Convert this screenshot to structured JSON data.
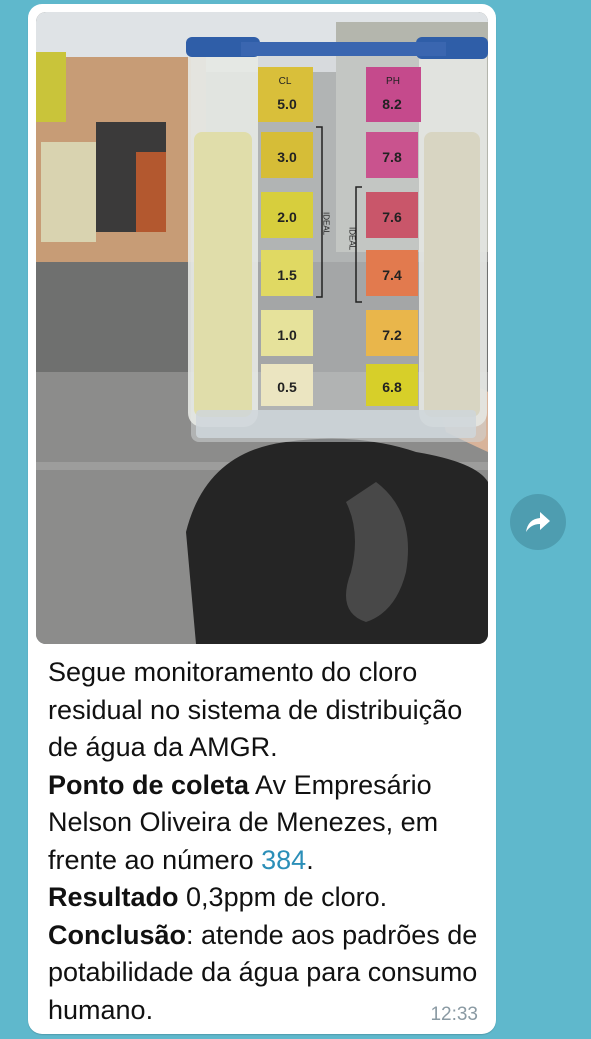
{
  "message": {
    "caption": {
      "line1": "Segue monitoramento do cloro residual no sistema de distribuição de água da AMGR.",
      "ponto_label": "Ponto de coleta",
      "ponto_text": " Av Empresário Nelson Oliveira de Menezes, em frente ao número ",
      "ponto_number": "384",
      "ponto_end": ".",
      "resultado_label": "Resultado",
      "resultado_text": " 0,3ppm de cloro.",
      "conclusao_label": "Conclusão",
      "conclusao_text": ": atende aos padrões de potabilidade da água para consumo humano."
    },
    "time": "12:33"
  },
  "photo": {
    "cl_header": "CL",
    "ph_header": "PH",
    "cl_values": [
      "5.0",
      "3.0",
      "2.0",
      "1.5",
      "1.0",
      "0.5"
    ],
    "ph_values": [
      "8.2",
      "7.8",
      "7.6",
      "7.4",
      "7.2",
      "6.8"
    ],
    "ideal_text": "IDEAL"
  },
  "forward_icon": "forward-arrow-icon"
}
